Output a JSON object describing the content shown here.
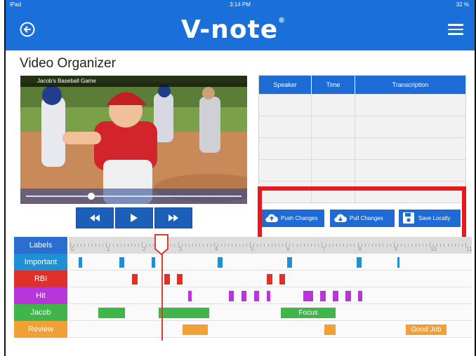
{
  "status_bar": {
    "device": "iPad",
    "time": "3:14 PM",
    "battery": "32 %"
  },
  "navbar": {
    "back_icon": "back-arrow-circle-icon",
    "logo_text": "V-note",
    "logo_mark": "®",
    "menu_icon": "hamburger-menu-icon"
  },
  "page": {
    "title": "Video Organizer"
  },
  "video": {
    "title": "Jacob's Baseball Game",
    "progress": 0.29
  },
  "transport": {
    "rewind_icon": "rewind-icon",
    "play_icon": "play-icon",
    "forward_icon": "fast-forward-icon"
  },
  "transcript": {
    "headers": {
      "speaker": "Speaker",
      "time": "Time",
      "transcription": "Transcription"
    }
  },
  "actions": {
    "push_label": "Push Changes",
    "pull_label": "Pull Changes",
    "save_label": "Save Locally"
  },
  "timeline": {
    "ruler_label": "Labels",
    "ruler_numbers": [
      "0",
      "1",
      "2",
      "3",
      "4",
      "5",
      "6",
      "7",
      "8",
      "9",
      "10",
      "11"
    ],
    "playhead_seconds": 2.6,
    "rows": [
      {
        "label": "Important",
        "color": "#1f8fd6"
      },
      {
        "label": "RBI",
        "color": "#e0302a"
      },
      {
        "label": "Hit",
        "color": "#b636d9"
      },
      {
        "label": "Jacob",
        "color": "#3fb54a",
        "bar_text": "Focus"
      },
      {
        "label": "Review",
        "color": "#f0a035",
        "bar_text": "Good Job"
      }
    ]
  }
}
